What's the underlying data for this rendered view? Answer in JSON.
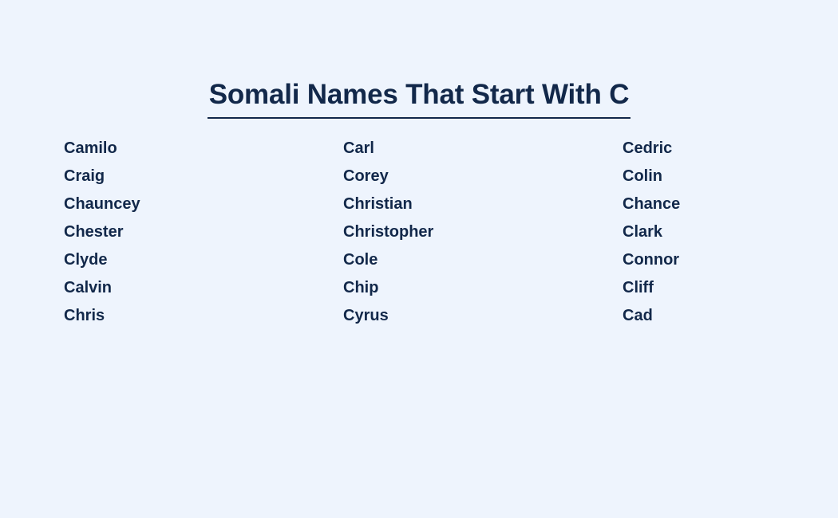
{
  "page": {
    "background_color": "#eef4fd",
    "text_color": "#12284a"
  },
  "header": {
    "title": "Somali Names That Start With C",
    "underline_color": "#12284a"
  },
  "name_list": {
    "columns": [
      {
        "names": [
          "Camilo",
          "Craig",
          "Chauncey",
          "Chester",
          "Clyde",
          "Calvin",
          "Chris"
        ]
      },
      {
        "names": [
          "Carl",
          "Corey",
          "Christian",
          "Christopher",
          "Cole",
          "Chip",
          "Cyrus"
        ]
      },
      {
        "names": [
          "Cedric",
          "Colin",
          "Chance",
          "Clark",
          "Connor",
          "Cliff",
          "Cad"
        ]
      }
    ]
  }
}
